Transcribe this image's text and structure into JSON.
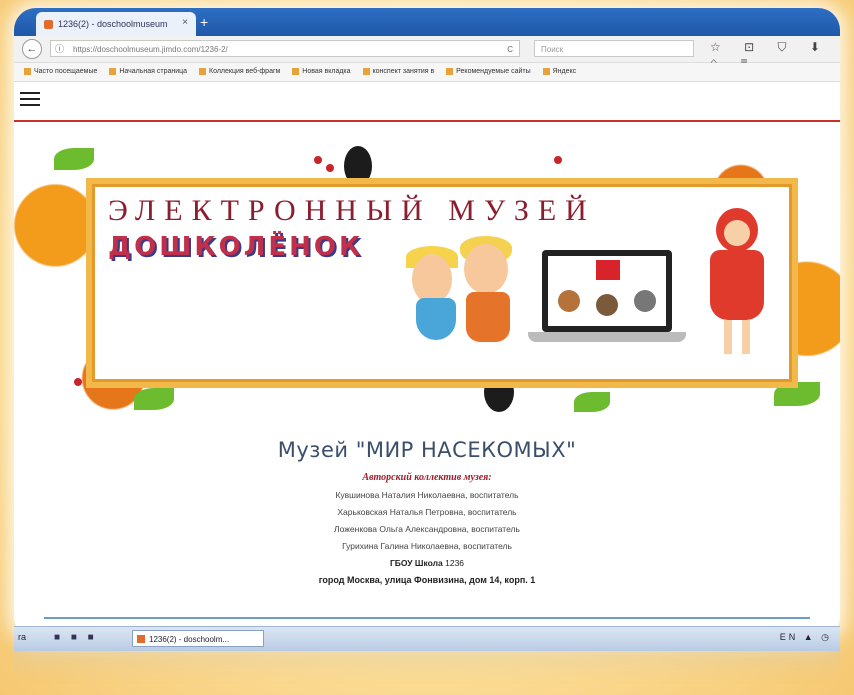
{
  "browser": {
    "tab_title": "1236(2) - doschoolmuseum",
    "tab_close": "×",
    "new_tab": "+",
    "url": "https://doschoolmuseum.jimdo.com/1236-2/",
    "search_placeholder": "Поиск",
    "back": "←",
    "info": "ⓘ",
    "reload": "C",
    "icons": "☆ ⊡ ⛉ ⬇ ⌂ ≡"
  },
  "bookmarks": [
    "Часто посещаемые",
    "Начальная страница",
    "Коллекция веб-фрагм",
    "Новая вкладка",
    "конспект занятия в",
    "Рекомендуемые сайты",
    "Яндекс"
  ],
  "banner": {
    "title_line1": "ЭЛЕКТРОННЫЙ МУЗЕЙ",
    "title_line2": "ДОШКОЛЁНОК"
  },
  "content": {
    "heading": "Музей \"МИР НАСЕКОМЫХ\"",
    "authors_label": "Авторский коллектив музея:",
    "authors": [
      "Кувшинова Наталия Николаевна, воспитатель",
      "Харьковская Наталья Петровна, воспитатель",
      "Ложенкова Ольга Александровна, воспитатель",
      "Гурихина Галина Николаевна, воспитатель"
    ],
    "school_bold": "ГБОУ Школа",
    "school_num": "1236",
    "address": "город Москва, улица Фонвизина, дом 14, корп. 1"
  },
  "taskbar": {
    "start": "ra",
    "button": "1236(2) - doschoolm...",
    "tray": "EN ▲ ◷"
  }
}
